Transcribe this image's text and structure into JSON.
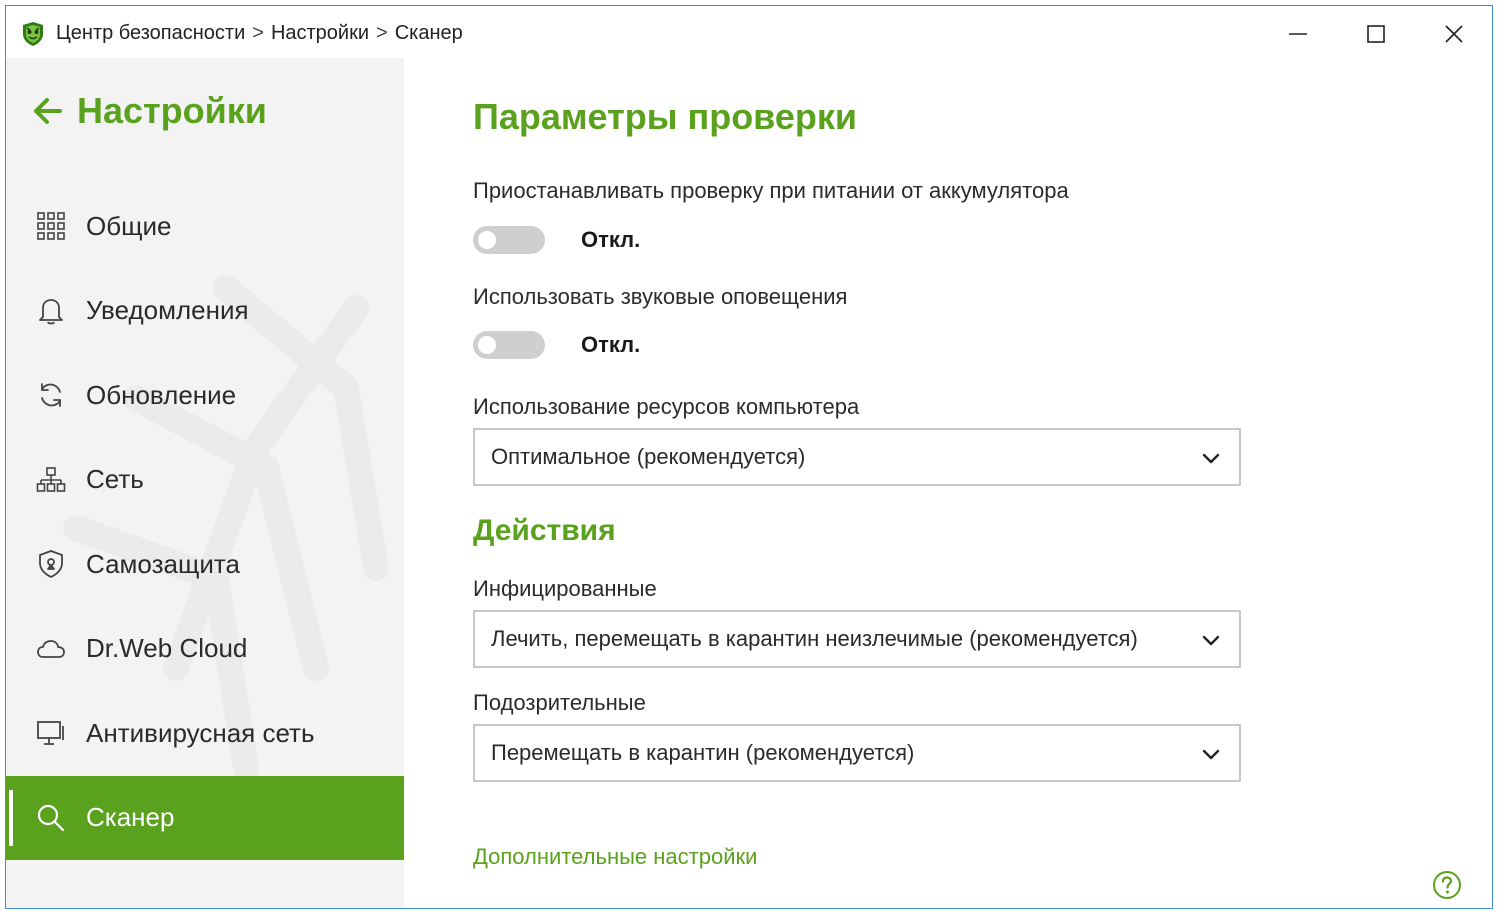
{
  "titlebar": {
    "breadcrumb": [
      "Центр безопасности",
      "Настройки",
      "Сканер"
    ],
    "separator": ">"
  },
  "sidebar": {
    "back_title": "Настройки",
    "items": [
      {
        "label": "Общие",
        "icon": "grid-icon"
      },
      {
        "label": "Уведомления",
        "icon": "bell-icon"
      },
      {
        "label": "Обновление",
        "icon": "refresh-icon"
      },
      {
        "label": "Сеть",
        "icon": "network-icon"
      },
      {
        "label": "Самозащита",
        "icon": "shield-icon"
      },
      {
        "label": "Dr.Web Cloud",
        "icon": "cloud-icon"
      },
      {
        "label": "Антивирусная сеть",
        "icon": "monitor-icon"
      },
      {
        "label": "Сканер",
        "icon": "search-icon",
        "active": true
      }
    ]
  },
  "main": {
    "title": "Параметры проверки",
    "battery": {
      "label": "Приостанавливать проверку при питании от аккумулятора",
      "state": "Откл.",
      "on": false
    },
    "sound": {
      "label": "Использовать звуковые оповещения",
      "state": "Откл.",
      "on": false
    },
    "resources": {
      "label": "Использование ресурсов компьютера",
      "value": "Оптимальное (рекомендуется)"
    },
    "actions_title": "Действия",
    "infected": {
      "label": "Инфицированные",
      "value": "Лечить, перемещать в карантин неизлечимые (рекомендуется)"
    },
    "suspicious": {
      "label": "Подозрительные",
      "value": "Перемещать в карантин (рекомендуется)"
    },
    "advanced_link": "Дополнительные настройки"
  },
  "colors": {
    "accent": "#5aa21d",
    "window_border": "#3c8fd6",
    "sidebar_bg": "#f3f3f3",
    "toggle_off": "#cfcfcf"
  }
}
